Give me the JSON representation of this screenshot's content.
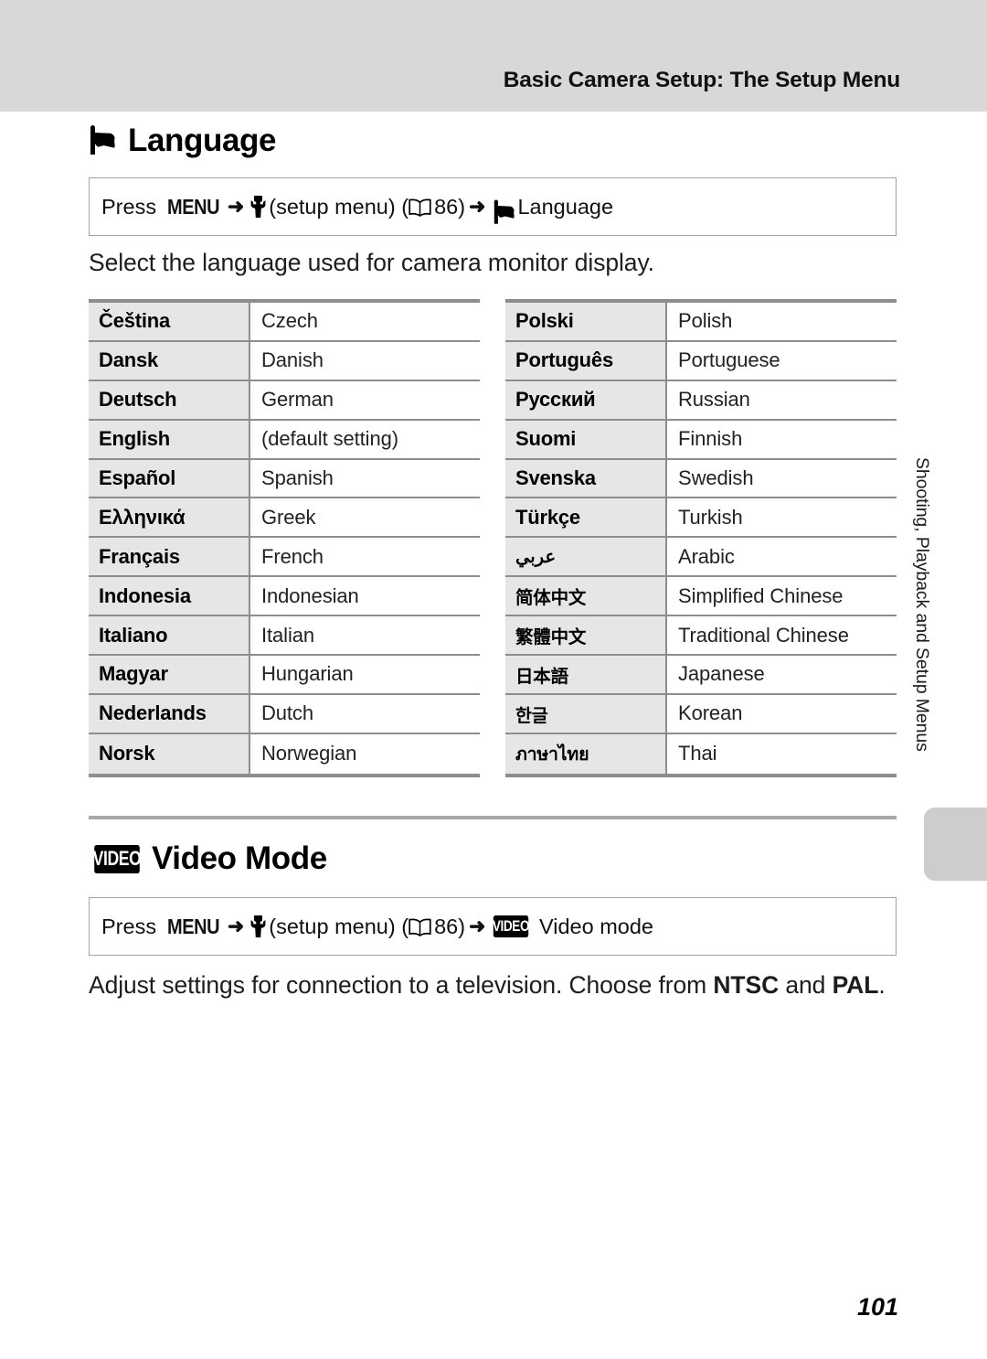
{
  "header": {
    "title": "Basic Camera Setup: The Setup Menu"
  },
  "sections": {
    "language": {
      "icon": "flag-icon",
      "heading": "Language",
      "press_path": {
        "prefix": "Press",
        "menu_key": "MENU",
        "arrow": "➜",
        "wrench_icon": "wrench-icon",
        "setup_menu_label": "(setup menu)",
        "open_paren": "(",
        "book_icon": "book-icon",
        "page_ref": "86",
        "close_paren": ")",
        "arrow2": "➜",
        "target_icon": "flag-icon",
        "target_label": "Language"
      },
      "intro": "Select the language used for camera monitor display.",
      "table_left": [
        {
          "native": "Čeština",
          "english": "Czech"
        },
        {
          "native": "Dansk",
          "english": "Danish"
        },
        {
          "native": "Deutsch",
          "english": "German"
        },
        {
          "native": "English",
          "english": "(default setting)"
        },
        {
          "native": "Español",
          "english": "Spanish"
        },
        {
          "native": "Ελληνικά",
          "english": "Greek"
        },
        {
          "native": "Français",
          "english": "French"
        },
        {
          "native": "Indonesia",
          "english": "Indonesian"
        },
        {
          "native": "Italiano",
          "english": "Italian"
        },
        {
          "native": "Magyar",
          "english": "Hungarian"
        },
        {
          "native": "Nederlands",
          "english": "Dutch"
        },
        {
          "native": "Norsk",
          "english": "Norwegian"
        }
      ],
      "table_right": [
        {
          "native": "Polski",
          "english": "Polish"
        },
        {
          "native": "Português",
          "english": "Portuguese"
        },
        {
          "native": "Русский",
          "english": "Russian"
        },
        {
          "native": "Suomi",
          "english": "Finnish"
        },
        {
          "native": "Svenska",
          "english": "Swedish"
        },
        {
          "native": "Türkçe",
          "english": "Turkish"
        },
        {
          "native": "عربي",
          "english": "Arabic"
        },
        {
          "native": "简体中文",
          "english": "Simplified Chinese"
        },
        {
          "native": "繁體中文",
          "english": "Traditional Chinese"
        },
        {
          "native": "日本語",
          "english": "Japanese"
        },
        {
          "native": "한글",
          "english": "Korean"
        },
        {
          "native": "ภาษาไทย",
          "english": "Thai"
        }
      ]
    },
    "video_mode": {
      "icon": "video-badge-icon",
      "icon_text": "VIDEO",
      "heading": "Video Mode",
      "press_path": {
        "prefix": "Press",
        "menu_key": "MENU",
        "arrow": "➜",
        "wrench_icon": "wrench-icon",
        "setup_menu_label": "(setup menu)",
        "open_paren": "(",
        "book_icon": "book-icon",
        "page_ref": "86",
        "close_paren": ")",
        "arrow2": "➜",
        "target_icon_text": "VIDEO",
        "target_label": "Video mode"
      },
      "intro_part1": "Adjust settings for connection to a television. Choose from ",
      "intro_bold1": "NTSC",
      "intro_part2": " and ",
      "intro_bold2": "PAL",
      "intro_part3": "."
    }
  },
  "side_tab": {
    "label": "Shooting, Playback and Setup Menus"
  },
  "footer": {
    "page_number": "101"
  },
  "colors": {
    "header_band": "#d8d8d8",
    "table_cell_gray": "#e6e6e6",
    "rule_gray": "#8d8d8d",
    "tab_gray": "#cdcdcd"
  }
}
